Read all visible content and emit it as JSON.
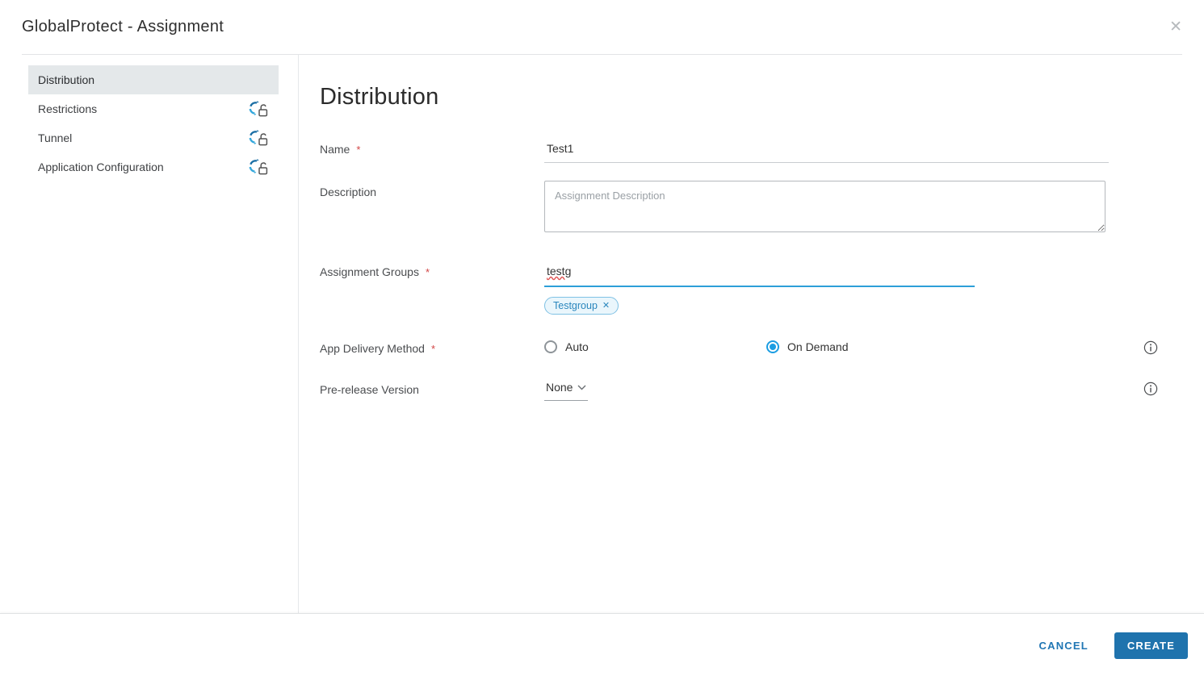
{
  "colors": {
    "accent_blue": "#1f73ad",
    "radio_blue": "#1b9de2",
    "focus_underline": "#2d9fd8",
    "chip_bg": "#eaf6fc",
    "chip_border": "#7fc1e4",
    "required_red": "#d24545",
    "sidebar_selected_bg": "#e4e8ea"
  },
  "header": {
    "title": "GlobalProtect - Assignment",
    "close_glyph": "✕"
  },
  "sidebar": {
    "items": [
      {
        "label": "Distribution",
        "selected": true,
        "icon": null
      },
      {
        "label": "Restrictions",
        "selected": false,
        "icon": "sync-unlocked-icon"
      },
      {
        "label": "Tunnel",
        "selected": false,
        "icon": "sync-unlocked-icon"
      },
      {
        "label": "Application Configuration",
        "selected": false,
        "icon": "sync-unlocked-icon"
      }
    ]
  },
  "main": {
    "heading": "Distribution",
    "fields": {
      "name": {
        "label": "Name",
        "required_marker": "*",
        "value": "Test1"
      },
      "description": {
        "label": "Description",
        "placeholder": "Assignment Description",
        "value": ""
      },
      "assignment_groups": {
        "label": "Assignment Groups",
        "required_marker": "*",
        "typed_value": "testg",
        "chips": [
          {
            "label": "Testgroup",
            "remove_glyph": "✕"
          }
        ]
      },
      "app_delivery_method": {
        "label": "App Delivery Method",
        "required_marker": "*",
        "options": [
          {
            "label": "Auto",
            "selected": false
          },
          {
            "label": "On Demand",
            "selected": true
          }
        ],
        "info_icon": "info-icon"
      },
      "prerelease_version": {
        "label": "Pre-release Version",
        "value": "None",
        "info_icon": "info-icon"
      }
    }
  },
  "footer": {
    "cancel_label": "CANCEL",
    "create_label": "CREATE"
  }
}
